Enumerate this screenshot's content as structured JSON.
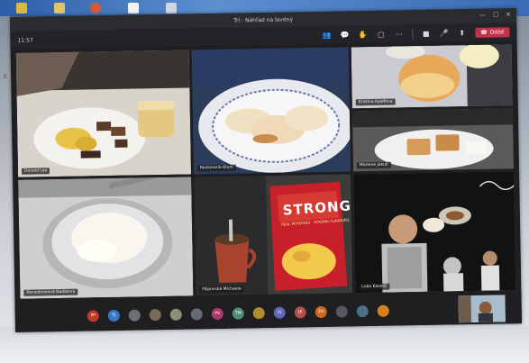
{
  "window": {
    "title": "Trí - Náhľad na lovéný",
    "clock": "11:57",
    "leave_label": "Odísť"
  },
  "tiles": [
    {
      "name": "Donald Lee"
    },
    {
      "name": "Rosemarie Blum"
    },
    {
      "name": "Kristina Kalefova"
    },
    {
      "name": "Marlene Jakub"
    },
    {
      "name": "Naradenieová Naďalova"
    },
    {
      "name": "Filipovská Michaela"
    },
    {
      "name": "Lubo Kaveljč"
    }
  ],
  "chips_brand": "STRONG",
  "chips_sub": "REAL POTATOES · STRONG FLAVOURS",
  "participants": [
    {
      "initials": "PP",
      "color": "#c0392b"
    },
    {
      "initials": "TJ",
      "color": "#3a78c2"
    },
    {
      "initials": "",
      "color": "#6b7078"
    },
    {
      "initials": "",
      "color": "#7a6a58"
    },
    {
      "initials": "",
      "color": "#8a8f76"
    },
    {
      "initials": "",
      "color": "#666a72"
    },
    {
      "initials": "PV",
      "color": "#a53b6d"
    },
    {
      "initials": "TM",
      "color": "#4d8f7a"
    },
    {
      "initials": "",
      "color": "#b08a2e"
    },
    {
      "initials": "DJ",
      "color": "#5f66b6"
    },
    {
      "initials": "JK",
      "color": "#b24e4e"
    },
    {
      "initials": "ZH",
      "color": "#c96a1e"
    },
    {
      "initials": "",
      "color": "#55595f"
    },
    {
      "initials": "",
      "color": "#4a6f86"
    },
    {
      "initials": "",
      "color": "#d6811f"
    }
  ]
}
